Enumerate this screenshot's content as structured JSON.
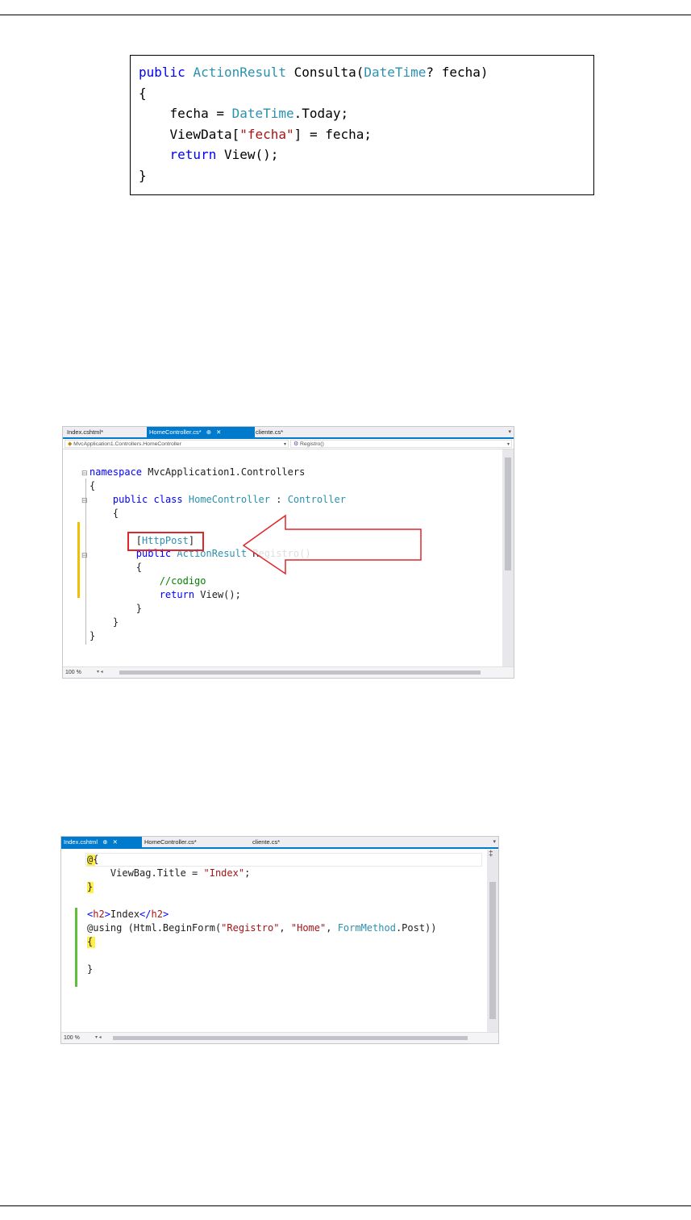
{
  "snippet1": {
    "lines": [
      [
        {
          "t": "public ",
          "c": "kw"
        },
        {
          "t": "ActionResult",
          "c": "ty"
        },
        {
          "t": " Consulta(",
          "c": ""
        },
        {
          "t": "DateTime",
          "c": "ty"
        },
        {
          "t": "? fecha)",
          "c": ""
        }
      ],
      [
        {
          "t": "{",
          "c": ""
        }
      ],
      [
        {
          "t": "    fecha = ",
          "c": ""
        },
        {
          "t": "DateTime",
          "c": "ty"
        },
        {
          "t": ".Today;",
          "c": ""
        }
      ],
      [
        {
          "t": "    ViewData[",
          "c": ""
        },
        {
          "t": "\"fecha\"",
          "c": "st"
        },
        {
          "t": "] = fecha;",
          "c": ""
        }
      ],
      [
        {
          "t": "    ",
          "c": ""
        },
        {
          "t": "return",
          "c": "kw"
        },
        {
          "t": " View();",
          "c": ""
        }
      ],
      [
        {
          "t": "}",
          "c": ""
        }
      ]
    ]
  },
  "ide1": {
    "tabs": [
      "Index.cshtml*",
      "HomeController.cs*",
      "cliente.cs*"
    ],
    "active_tab": "HomeController.cs*",
    "tab_pin": "⊕",
    "tab_close": "✕",
    "nav_left": "MvcApplication1.Controllers.HomeController",
    "nav_right": "Registro()",
    "zoom": "100 %",
    "lines": [
      [
        {
          "t": "namespace",
          "c": "kw"
        },
        {
          "t": " MvcApplication1.Controllers",
          "c": ""
        }
      ],
      [
        {
          "t": "{",
          "c": ""
        }
      ],
      [
        {
          "t": "    ",
          "c": ""
        },
        {
          "t": "public",
          "c": "kw"
        },
        {
          "t": " ",
          "c": ""
        },
        {
          "t": "class",
          "c": "kw"
        },
        {
          "t": " ",
          "c": ""
        },
        {
          "t": "HomeController",
          "c": "ty"
        },
        {
          "t": " : ",
          "c": ""
        },
        {
          "t": "Controller",
          "c": "ty"
        }
      ],
      [
        {
          "t": "    {",
          "c": ""
        }
      ],
      [
        {
          "t": "",
          "c": ""
        }
      ],
      [
        {
          "t": "        [",
          "c": ""
        },
        {
          "t": "HttpPost",
          "c": "ty"
        },
        {
          "t": "]",
          "c": ""
        }
      ],
      [
        {
          "t": "        ",
          "c": ""
        },
        {
          "t": "public",
          "c": "kw"
        },
        {
          "t": " ",
          "c": ""
        },
        {
          "t": "ActionResult",
          "c": "ty"
        },
        {
          "t": " Registro()",
          "c": ""
        }
      ],
      [
        {
          "t": "        {",
          "c": ""
        }
      ],
      [
        {
          "t": "            ",
          "c": ""
        },
        {
          "t": "//codigo",
          "c": "cm"
        }
      ],
      [
        {
          "t": "            ",
          "c": ""
        },
        {
          "t": "return",
          "c": "kw"
        },
        {
          "t": " View();",
          "c": ""
        }
      ],
      [
        {
          "t": "        }",
          "c": ""
        }
      ],
      [
        {
          "t": "    }",
          "c": ""
        }
      ],
      [
        {
          "t": "}",
          "c": ""
        }
      ]
    ],
    "highlight_color": "#e0262b"
  },
  "ide2": {
    "tabs": [
      "Index.cshtml",
      "HomeController.cs*",
      "cliente.cs*"
    ],
    "active_tab": "Index.cshtml",
    "tab_pin": "⊕",
    "tab_close": "✕",
    "zoom": "100 %",
    "lines": [
      [
        {
          "t": "@{",
          "c": ""
        }
      ],
      [
        {
          "t": "    ViewBag.Title = ",
          "c": ""
        },
        {
          "t": "\"Index\"",
          "c": "st"
        },
        {
          "t": ";",
          "c": ""
        }
      ],
      [
        {
          "t": "}",
          "c": ""
        }
      ],
      [
        {
          "t": "",
          "c": ""
        }
      ],
      [
        {
          "t": "<",
          "c": "kw"
        },
        {
          "t": "h2",
          "c": "st"
        },
        {
          "t": ">",
          "c": "kw"
        },
        {
          "t": "Index",
          "c": ""
        },
        {
          "t": "</",
          "c": "kw"
        },
        {
          "t": "h2",
          "c": "st"
        },
        {
          "t": ">",
          "c": "kw"
        }
      ],
      [
        {
          "t": "@using (Html.BeginForm(",
          "c": ""
        },
        {
          "t": "\"Registro\"",
          "c": "st"
        },
        {
          "t": ", ",
          "c": ""
        },
        {
          "t": "\"Home\"",
          "c": "st"
        },
        {
          "t": ", ",
          "c": ""
        },
        {
          "t": "FormMethod",
          "c": "ty"
        },
        {
          "t": ".Post))",
          "c": ""
        }
      ],
      [
        {
          "t": "{",
          "c": ""
        }
      ],
      [
        {
          "t": "",
          "c": ""
        }
      ],
      [
        {
          "t": "}",
          "c": ""
        }
      ]
    ]
  }
}
